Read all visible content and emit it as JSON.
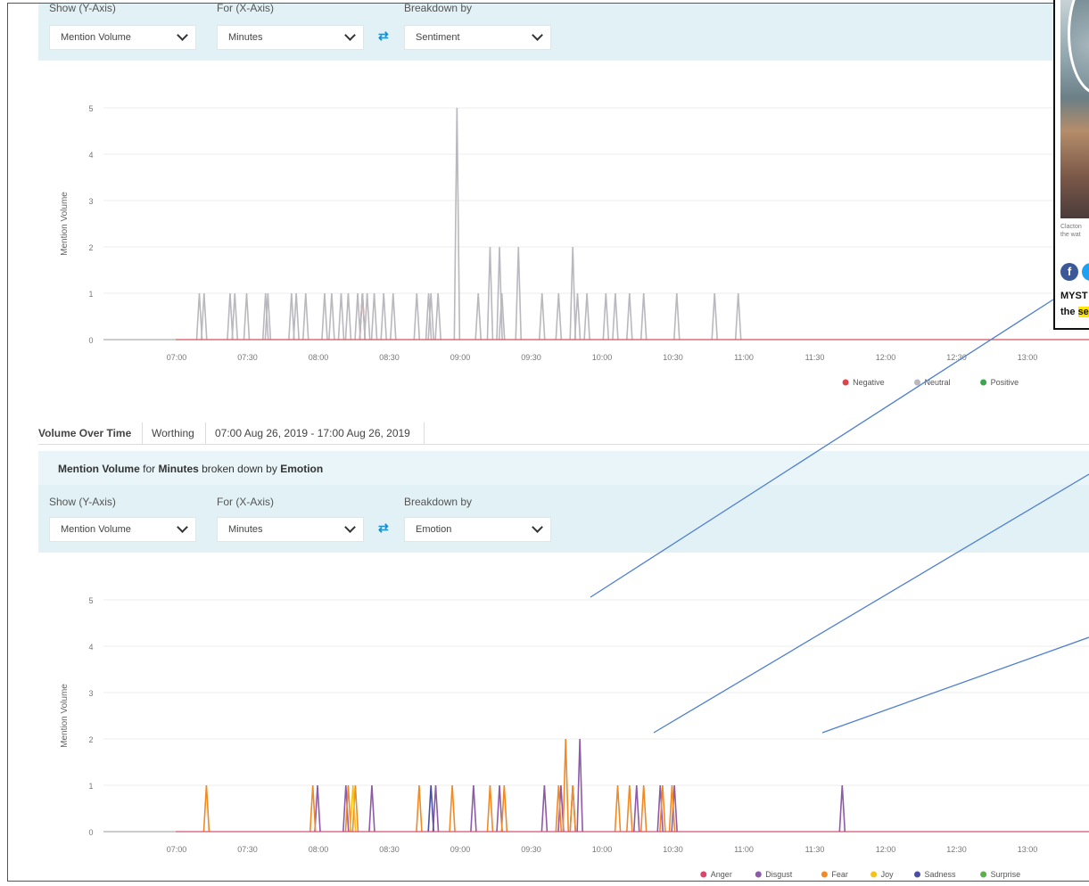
{
  "top_controls": {
    "show_label": "Show (Y-Axis)",
    "for_label": "For (X-Axis)",
    "breakdown_label": "Breakdown by",
    "show_value": "Mention Volume",
    "for_value": "Minutes",
    "breakdown_value": "Sentiment"
  },
  "tabs": {
    "tab1": "Volume Over Time",
    "tab2": "Worthing",
    "tab3": "07:00 Aug 26, 2019 - 17:00 Aug 26, 2019"
  },
  "bottom_header": {
    "part1": "Mention Volume",
    "part2": " for ",
    "part3": "Minutes",
    "part4": " broken down by ",
    "part5": "Emotion"
  },
  "bottom_controls": {
    "show_label": "Show (Y-Axis)",
    "for_label": "For (X-Axis)",
    "breakdown_label": "Breakdown by",
    "show_value": "Mention Volume",
    "for_value": "Minutes",
    "breakdown_value": "Emotion"
  },
  "article": {
    "caption_line1": "Clacton",
    "caption_line2": "the wat",
    "headline_line1": "MYST",
    "headline_line2_plain": "the ",
    "headline_line2_highlight": "se",
    "facebook_glyph": "f"
  },
  "colors": {
    "panel": "#e2f1f5",
    "callout_line": "#4f7fd0"
  },
  "chart_data": [
    {
      "type": "line",
      "ylabel": "Mention Volume",
      "ylim": [
        0,
        5
      ],
      "yticks": [
        "0",
        "1",
        "2",
        "3",
        "4",
        "5"
      ],
      "xticks": [
        "07:00",
        "07:30",
        "08:00",
        "08:30",
        "09:00",
        "09:30",
        "10:00",
        "10:30",
        "11:00",
        "11:30",
        "12:00",
        "12:30",
        "13:00",
        "1"
      ],
      "grid": true,
      "legend": {
        "placement": "bottom-right",
        "entries": [
          "Negative",
          "Neutral",
          "Positive"
        ]
      },
      "series": [
        {
          "name": "Negative",
          "color": "#d9454b",
          "points": [
            [
              79,
              1
            ]
          ]
        },
        {
          "name": "Neutral",
          "color": "#b8b8be",
          "points": [
            [
              10,
              1
            ],
            [
              12,
              1
            ],
            [
              23,
              1
            ],
            [
              25,
              1
            ],
            [
              30,
              1
            ],
            [
              38,
              1
            ],
            [
              39,
              1
            ],
            [
              49,
              1
            ],
            [
              51,
              1
            ],
            [
              55,
              1
            ],
            [
              63,
              1
            ],
            [
              66,
              1
            ],
            [
              70,
              1
            ],
            [
              73,
              1
            ],
            [
              77,
              1
            ],
            [
              79,
              1
            ],
            [
              81,
              1
            ],
            [
              84,
              1
            ],
            [
              88,
              1
            ],
            [
              92,
              1
            ],
            [
              102,
              1
            ],
            [
              107,
              1
            ],
            [
              108,
              1
            ],
            [
              111,
              1
            ],
            [
              119,
              5
            ],
            [
              128,
              1
            ],
            [
              133,
              2
            ],
            [
              137,
              2
            ],
            [
              138,
              1
            ],
            [
              145,
              2
            ],
            [
              155,
              1
            ],
            [
              162,
              1
            ],
            [
              168,
              2
            ],
            [
              170,
              1
            ],
            [
              174,
              1
            ],
            [
              182,
              1
            ],
            [
              186,
              1
            ],
            [
              192,
              1
            ],
            [
              198,
              1
            ],
            [
              212,
              1
            ],
            [
              228,
              1
            ],
            [
              238,
              1
            ]
          ]
        },
        {
          "name": "Positive",
          "color": "#3aa64c",
          "points": []
        }
      ]
    },
    {
      "type": "line",
      "ylabel": "Mention Volume",
      "ylim": [
        0,
        5
      ],
      "yticks": [
        "0",
        "1",
        "2",
        "3",
        "4",
        "5"
      ],
      "xticks": [
        "07:00",
        "07:30",
        "08:00",
        "08:30",
        "09:00",
        "09:30",
        "10:00",
        "10:30",
        "11:00",
        "11:30",
        "12:00",
        "12:30",
        "13:00",
        "1"
      ],
      "grid": true,
      "legend": {
        "placement": "bottom-right",
        "entries": [
          "Anger",
          "Disgust",
          "Fear",
          "Joy",
          "Sadness",
          "Surprise"
        ]
      },
      "series": [
        {
          "name": "Anger",
          "color": "#d9456b",
          "points": []
        },
        {
          "name": "Disgust",
          "color": "#8e5aa8",
          "points": [
            [
              60,
              1
            ],
            [
              72,
              1
            ],
            [
              83,
              1
            ],
            [
              110,
              1
            ],
            [
              126,
              1
            ],
            [
              137,
              1
            ],
            [
              156,
              1
            ],
            [
              163,
              1
            ],
            [
              168,
              1
            ],
            [
              171,
              2
            ],
            [
              195,
              1
            ],
            [
              205,
              1
            ],
            [
              211,
              1
            ],
            [
              282,
              1
            ]
          ]
        },
        {
          "name": "Fear",
          "color": "#f08a24",
          "points": [
            [
              13,
              1
            ],
            [
              58,
              1
            ],
            [
              73,
              1
            ],
            [
              76,
              1
            ],
            [
              103,
              1
            ],
            [
              117,
              1
            ],
            [
              133,
              1
            ],
            [
              139,
              1
            ],
            [
              162,
              1
            ],
            [
              165,
              2
            ],
            [
              168,
              1
            ],
            [
              187,
              1
            ],
            [
              192,
              1
            ],
            [
              198,
              1
            ],
            [
              206,
              1
            ],
            [
              210,
              1
            ]
          ]
        },
        {
          "name": "Joy",
          "color": "#f2c318",
          "points": [
            [
              75,
              1
            ]
          ]
        },
        {
          "name": "Sadness",
          "color": "#4a4ea0",
          "points": [
            [
              108,
              1
            ]
          ]
        },
        {
          "name": "Surprise",
          "color": "#5bb04a",
          "points": []
        }
      ]
    }
  ]
}
